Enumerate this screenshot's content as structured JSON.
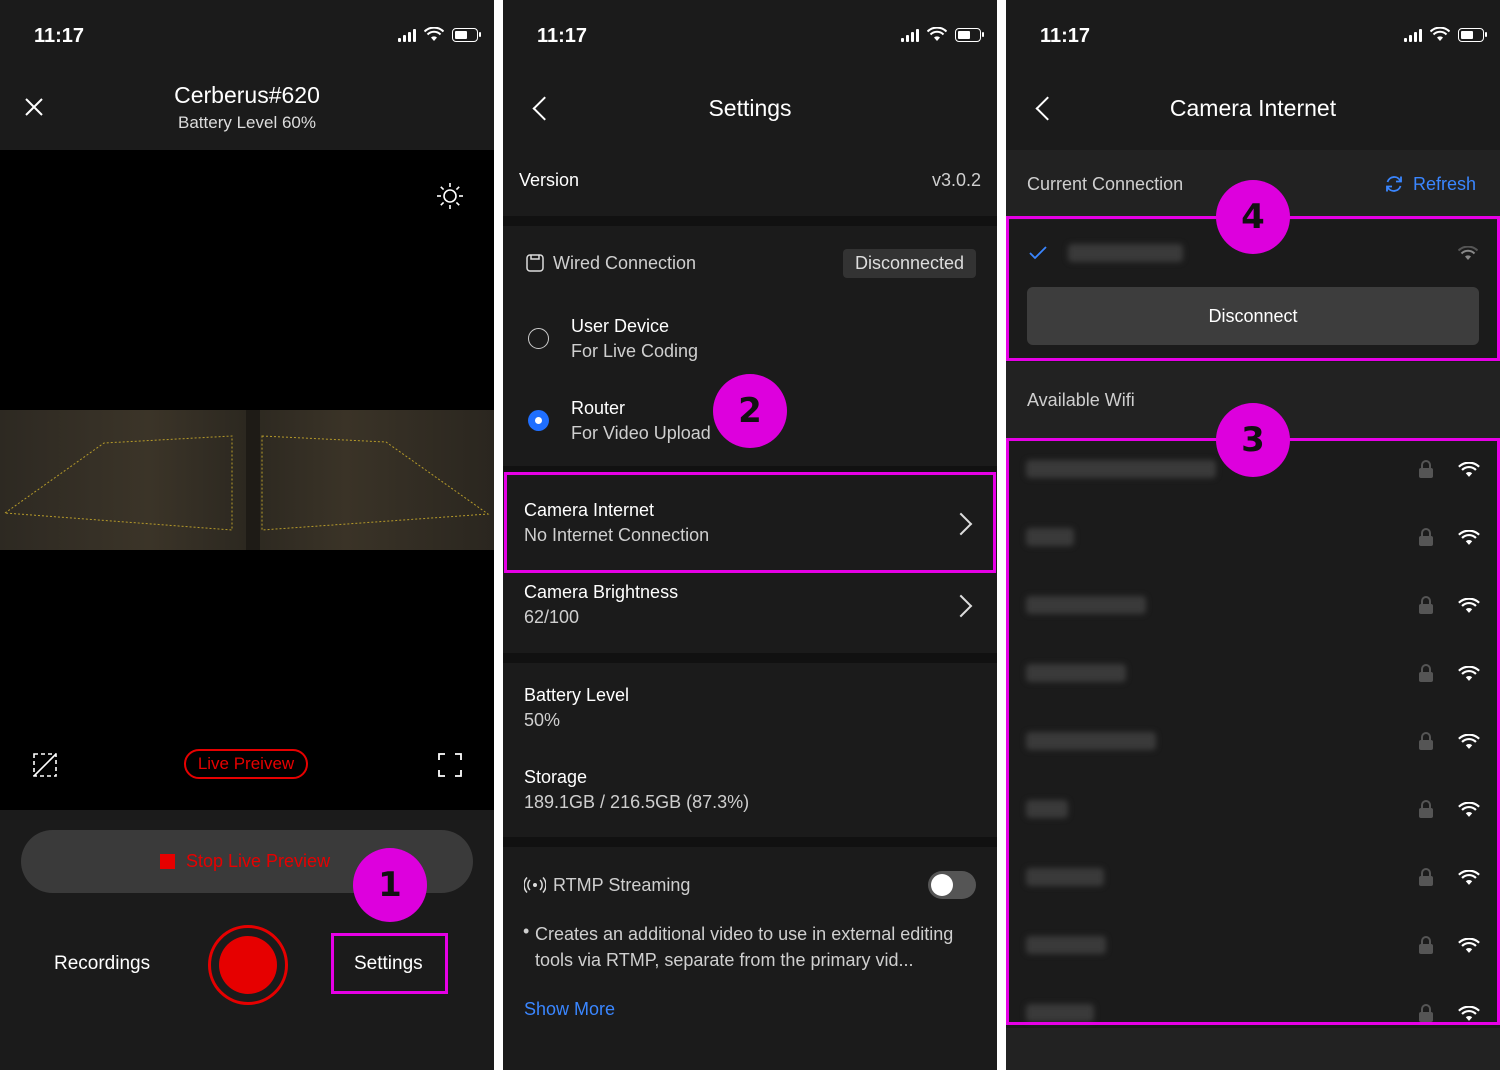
{
  "status_bar": {
    "time": "11:17"
  },
  "screen1": {
    "device_name": "Cerberus#620",
    "battery_level": "Battery Level 60%",
    "live_badge": "Live Preivew",
    "stop_button": "Stop Live Preview",
    "recordings": "Recordings",
    "settings": "Settings"
  },
  "screen2": {
    "title": "Settings",
    "version_label": "Version",
    "version_value": "v3.0.2",
    "wired_label": "Wired Connection",
    "wired_status": "Disconnected",
    "options": [
      {
        "title": "User Device",
        "subtitle": "For Live Coding",
        "selected": false
      },
      {
        "title": "Router",
        "subtitle": "For Video Upload",
        "selected": true
      }
    ],
    "camera_internet_title": "Camera Internet",
    "camera_internet_sub": "No Internet Connection",
    "brightness_title": "Camera Brightness",
    "brightness_value": "62/100",
    "battery_title": "Battery Level",
    "battery_value": "50%",
    "storage_title": "Storage",
    "storage_value": "189.1GB / 216.5GB (87.3%)",
    "rtmp_label": "RTMP Streaming",
    "rtmp_enabled": false,
    "rtmp_desc": "Creates an additional video to use in external editing tools via RTMP, separate from the primary vid...",
    "show_more": "Show More"
  },
  "screen3": {
    "title": "Camera Internet",
    "current_connection": "Current Connection",
    "refresh": "Refresh",
    "disconnect": "Disconnect",
    "available_wifi": "Available Wifi",
    "wifi_count": 9
  },
  "annotations": {
    "b1": "1",
    "b2": "2",
    "b3": "3",
    "b4": "4"
  },
  "colors": {
    "accent_blue": "#3a86ff",
    "annotation": "#e600e6",
    "record_red": "#e60000"
  }
}
